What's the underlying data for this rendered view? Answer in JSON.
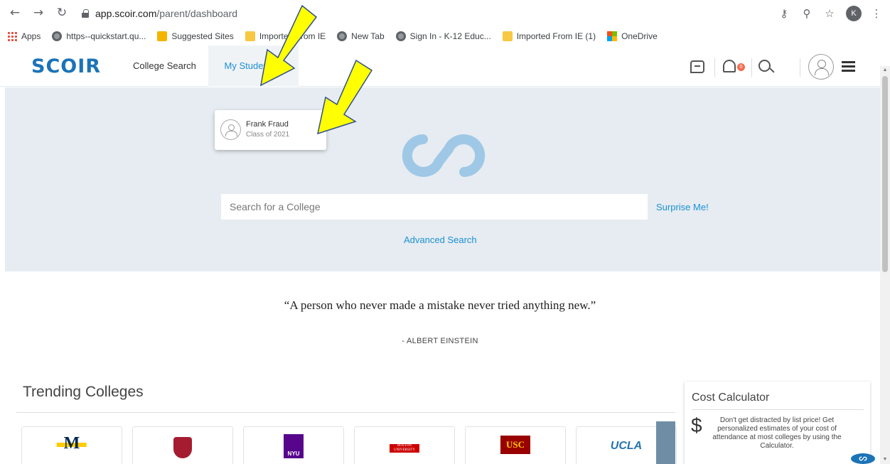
{
  "browser": {
    "url_host": "app.scoir.com",
    "url_path": "/parent/dashboard",
    "profile_initial": "K",
    "bookmarks": [
      {
        "label": "Apps",
        "icon": "apps-grid-icon"
      },
      {
        "label": "https--quickstart.qu...",
        "icon": "globe-icon"
      },
      {
        "label": "Suggested Sites",
        "icon": "bing-icon"
      },
      {
        "label": "Imported From IE",
        "icon": "folder-icon"
      },
      {
        "label": "New Tab",
        "icon": "globe-icon"
      },
      {
        "label": "Sign In - K-12 Educ...",
        "icon": "globe-icon"
      },
      {
        "label": "Imported From IE (1)",
        "icon": "folder-icon"
      },
      {
        "label": "OneDrive",
        "icon": "microsoft-icon"
      }
    ]
  },
  "header": {
    "logo": "SCOIR",
    "nav": {
      "college_search": "College Search",
      "my_students": "My Students ^"
    },
    "notification_count": "0",
    "brand_color": "#1b73b8",
    "accent_color": "#1b8fd6"
  },
  "dropdown": {
    "student_name": "Frank Fraud",
    "student_class": "Class of 2021"
  },
  "hero": {
    "search_placeholder": "Search for a College",
    "surprise": "Surprise Me!",
    "advanced": "Advanced Search"
  },
  "quote": {
    "text": "“A person who never made a mistake never tried anything new.”",
    "author": "- ALBERT EINSTEIN"
  },
  "trending": {
    "title": "Trending Colleges",
    "colleges": [
      "M",
      "Harvard",
      "NYU",
      "BOSTON UNIVERSITY",
      "USC",
      "UCLA"
    ]
  },
  "cost_calculator": {
    "title": "Cost Calculator",
    "symbol": "$",
    "description": "Don't get distracted by list price! Get personalized estimates of your cost of attendance at most colleges by using the Calculator."
  }
}
